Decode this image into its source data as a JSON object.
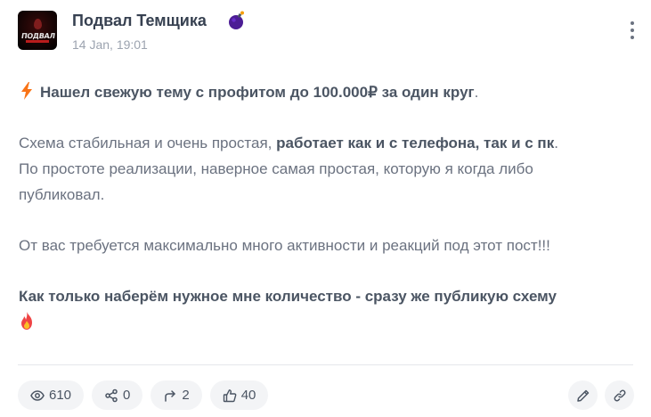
{
  "channel": {
    "name": "Подвал Темщика",
    "date": "14 Jan, 19:01",
    "avatar_text": "ПОДВАЛ"
  },
  "post": {
    "line1": "Нашел свежую тему с профитом до 100.000₽ за один круг",
    "line1_end": ".",
    "p2_start": "Схема стабильная и очень простая, ",
    "p2_bold": "работает как и с телефона, так и с пк",
    "p2_end": ".",
    "p2_line2": "По простоте реализации, наверное самая простая, которую я когда либо",
    "p2_line3": "публиковал.",
    "p3": "От вас требуется максимально много активности и реакций под этот пост!!!",
    "p4_bold": "Как только наберём нужное мне количество - сразу же публикую схему"
  },
  "stats": {
    "views": "610",
    "shares": "0",
    "forwards": "2",
    "likes": "40"
  },
  "icons": {
    "avatar": "channel-avatar",
    "bomb": "bomb-icon",
    "menu": "more-vertical-icon",
    "lightning": "lightning-icon",
    "fire": "fire-icon",
    "views": "eye-icon",
    "shares": "share-icon",
    "forwards": "forward-icon",
    "likes": "thumbs-up-icon",
    "edit": "pencil-icon",
    "link": "link-icon"
  },
  "colors": {
    "text": "#6b7280",
    "bold": "#4b5563",
    "pill_bg": "#f3f4f6",
    "lightning": "#f97316",
    "fire": "#ef4444"
  }
}
